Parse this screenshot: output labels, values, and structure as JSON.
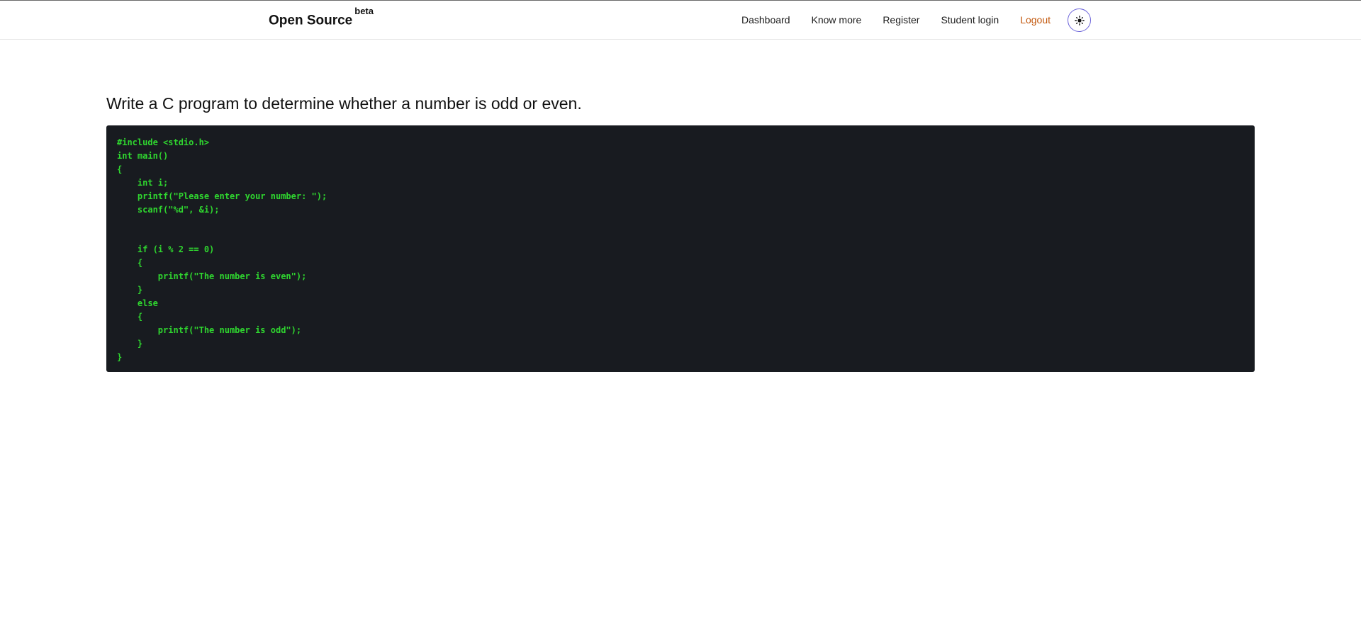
{
  "header": {
    "brand": "Open Source",
    "brand_badge": "beta",
    "nav": [
      {
        "label": "Dashboard"
      },
      {
        "label": "Know more"
      },
      {
        "label": "Register"
      },
      {
        "label": "Student login"
      },
      {
        "label": "Logout"
      }
    ],
    "theme_toggle_icon": "sun-icon",
    "logout_color": "#c2570c",
    "toggle_border_color": "#6b63d9"
  },
  "main": {
    "title": "Write a C program to determine whether a number is odd or even.",
    "code": "#include <stdio.h>\nint main()\n{\n    int i;\n    printf(\"Please enter your number: \");\n    scanf(\"%d\", &i);\n\n\n    if (i % 2 == 0)\n    {\n        printf(\"The number is even\");\n    }\n    else\n    {\n        printf(\"The number is odd\");\n    }\n}",
    "code_bg": "#181b20",
    "code_color": "#2fd62f"
  }
}
